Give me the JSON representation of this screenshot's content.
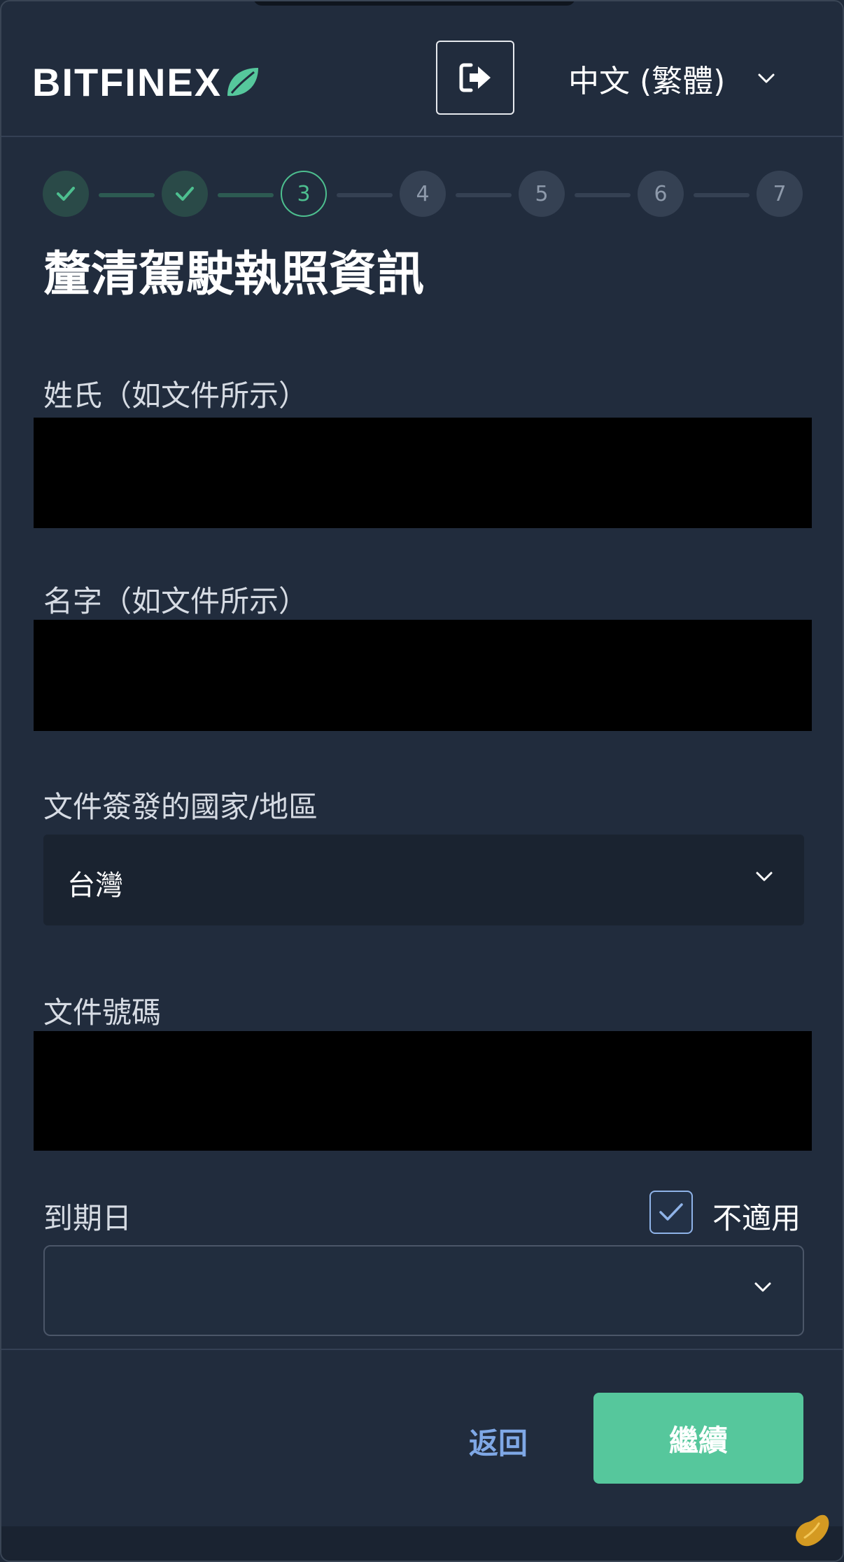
{
  "header": {
    "logo_text": "BITFINEX",
    "logout_icon": "sign-out-icon",
    "language": "中文 (繁體)"
  },
  "stepper": {
    "steps": [
      "",
      "",
      "3",
      "4",
      "5",
      "6",
      "7"
    ],
    "current_step": 3,
    "total_steps": 7
  },
  "form": {
    "title": "釐清駕駛執照資訊",
    "last_name_label": "姓氏（如文件所示）",
    "first_name_label": "名字（如文件所示）",
    "country_label": "文件簽發的國家/地區",
    "country_value": "台灣",
    "doc_number_label": "文件號碼",
    "expiry_label": "到期日",
    "expiry_value": "",
    "not_applicable_label": "不適用",
    "not_applicable_checked": true
  },
  "footer": {
    "back_label": "返回",
    "continue_label": "繼續"
  },
  "colors": {
    "background": "#212c3d",
    "accent": "#56c79c",
    "link": "#7fa8e6"
  }
}
